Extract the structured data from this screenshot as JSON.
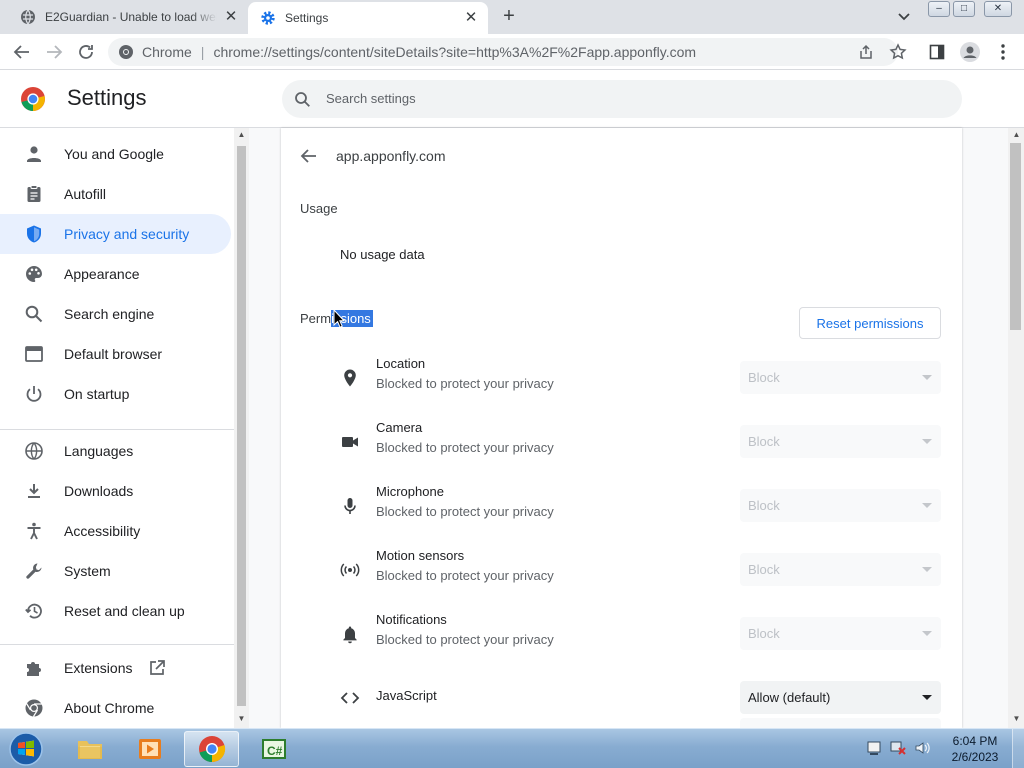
{
  "browser": {
    "tabs": [
      {
        "title": "E2Guardian - Unable to load web page",
        "active": false
      },
      {
        "title": "Settings",
        "active": true
      }
    ],
    "new_tab_label": "+",
    "window_controls": {
      "minimize": "–",
      "maximize": "□",
      "close": "✕"
    },
    "omnibox": {
      "security_label": "Chrome",
      "separator": "|",
      "url": "chrome://settings/content/siteDetails?site=http%3A%2F%2Fapp.apponfly.com"
    }
  },
  "settings": {
    "title": "Settings",
    "search_placeholder": "Search settings"
  },
  "sidebar": {
    "items": [
      {
        "label": "You and Google",
        "icon": "person-icon"
      },
      {
        "label": "Autofill",
        "icon": "clipboard-icon"
      },
      {
        "label": "Privacy and security",
        "icon": "shield-icon",
        "active": true
      },
      {
        "label": "Appearance",
        "icon": "palette-icon"
      },
      {
        "label": "Search engine",
        "icon": "search-icon"
      },
      {
        "label": "Default browser",
        "icon": "browser-icon"
      },
      {
        "label": "On startup",
        "icon": "power-icon"
      },
      {
        "label": "Languages",
        "icon": "globe-icon"
      },
      {
        "label": "Downloads",
        "icon": "download-icon"
      },
      {
        "label": "Accessibility",
        "icon": "accessibility-icon"
      },
      {
        "label": "System",
        "icon": "wrench-icon"
      },
      {
        "label": "Reset and clean up",
        "icon": "history-icon"
      },
      {
        "label": "Extensions",
        "icon": "puzzle-icon"
      },
      {
        "label": "About Chrome",
        "icon": "chrome-icon"
      }
    ]
  },
  "site_details": {
    "site": "app.apponfly.com",
    "usage_heading": "Usage",
    "usage_value": "No usage data",
    "permissions_heading_plain": "Perm",
    "permissions_heading_selected": "issions",
    "reset_button": "Reset permissions",
    "permissions": [
      {
        "name": "Location",
        "description": "Blocked to protect your privacy",
        "value": "Block",
        "icon": "location-pin-icon",
        "enabled": false
      },
      {
        "name": "Camera",
        "description": "Blocked to protect your privacy",
        "value": "Block",
        "icon": "camera-icon",
        "enabled": false
      },
      {
        "name": "Microphone",
        "description": "Blocked to protect your privacy",
        "value": "Block",
        "icon": "microphone-icon",
        "enabled": false
      },
      {
        "name": "Motion sensors",
        "description": "Blocked to protect your privacy",
        "value": "Block",
        "icon": "motion-sensors-icon",
        "enabled": false
      },
      {
        "name": "Notifications",
        "description": "Blocked to protect your privacy",
        "value": "Block",
        "icon": "bell-icon",
        "enabled": false
      },
      {
        "name": "JavaScript",
        "description": "",
        "value": "Allow (default)",
        "icon": "code-icon",
        "enabled": true
      }
    ]
  },
  "taskbar": {
    "apps": [
      "file-explorer",
      "media-player",
      "chrome",
      "csharp-editor"
    ],
    "clock_time": "6:04 PM",
    "clock_date": "2/6/2023"
  },
  "colors": {
    "accent": "#1a73e8",
    "active_nav_bg": "#e8f0fe",
    "selection": "#3478e1"
  }
}
